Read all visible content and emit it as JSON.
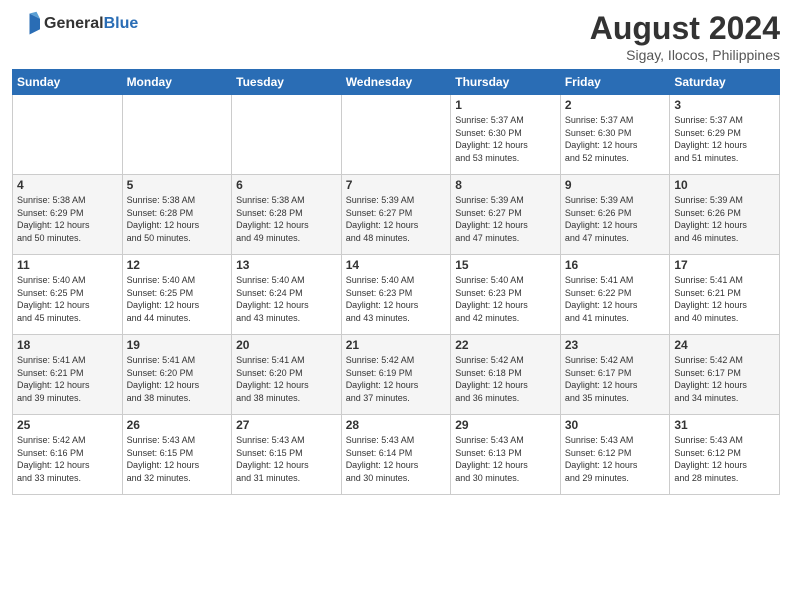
{
  "header": {
    "logo_general": "General",
    "logo_blue": "Blue",
    "month_year": "August 2024",
    "location": "Sigay, Ilocos, Philippines"
  },
  "weekdays": [
    "Sunday",
    "Monday",
    "Tuesday",
    "Wednesday",
    "Thursday",
    "Friday",
    "Saturday"
  ],
  "weeks": [
    [
      {
        "day": "",
        "info": ""
      },
      {
        "day": "",
        "info": ""
      },
      {
        "day": "",
        "info": ""
      },
      {
        "day": "",
        "info": ""
      },
      {
        "day": "1",
        "info": "Sunrise: 5:37 AM\nSunset: 6:30 PM\nDaylight: 12 hours\nand 53 minutes."
      },
      {
        "day": "2",
        "info": "Sunrise: 5:37 AM\nSunset: 6:30 PM\nDaylight: 12 hours\nand 52 minutes."
      },
      {
        "day": "3",
        "info": "Sunrise: 5:37 AM\nSunset: 6:29 PM\nDaylight: 12 hours\nand 51 minutes."
      }
    ],
    [
      {
        "day": "4",
        "info": "Sunrise: 5:38 AM\nSunset: 6:29 PM\nDaylight: 12 hours\nand 50 minutes."
      },
      {
        "day": "5",
        "info": "Sunrise: 5:38 AM\nSunset: 6:28 PM\nDaylight: 12 hours\nand 50 minutes."
      },
      {
        "day": "6",
        "info": "Sunrise: 5:38 AM\nSunset: 6:28 PM\nDaylight: 12 hours\nand 49 minutes."
      },
      {
        "day": "7",
        "info": "Sunrise: 5:39 AM\nSunset: 6:27 PM\nDaylight: 12 hours\nand 48 minutes."
      },
      {
        "day": "8",
        "info": "Sunrise: 5:39 AM\nSunset: 6:27 PM\nDaylight: 12 hours\nand 47 minutes."
      },
      {
        "day": "9",
        "info": "Sunrise: 5:39 AM\nSunset: 6:26 PM\nDaylight: 12 hours\nand 47 minutes."
      },
      {
        "day": "10",
        "info": "Sunrise: 5:39 AM\nSunset: 6:26 PM\nDaylight: 12 hours\nand 46 minutes."
      }
    ],
    [
      {
        "day": "11",
        "info": "Sunrise: 5:40 AM\nSunset: 6:25 PM\nDaylight: 12 hours\nand 45 minutes."
      },
      {
        "day": "12",
        "info": "Sunrise: 5:40 AM\nSunset: 6:25 PM\nDaylight: 12 hours\nand 44 minutes."
      },
      {
        "day": "13",
        "info": "Sunrise: 5:40 AM\nSunset: 6:24 PM\nDaylight: 12 hours\nand 43 minutes."
      },
      {
        "day": "14",
        "info": "Sunrise: 5:40 AM\nSunset: 6:23 PM\nDaylight: 12 hours\nand 43 minutes."
      },
      {
        "day": "15",
        "info": "Sunrise: 5:40 AM\nSunset: 6:23 PM\nDaylight: 12 hours\nand 42 minutes."
      },
      {
        "day": "16",
        "info": "Sunrise: 5:41 AM\nSunset: 6:22 PM\nDaylight: 12 hours\nand 41 minutes."
      },
      {
        "day": "17",
        "info": "Sunrise: 5:41 AM\nSunset: 6:21 PM\nDaylight: 12 hours\nand 40 minutes."
      }
    ],
    [
      {
        "day": "18",
        "info": "Sunrise: 5:41 AM\nSunset: 6:21 PM\nDaylight: 12 hours\nand 39 minutes."
      },
      {
        "day": "19",
        "info": "Sunrise: 5:41 AM\nSunset: 6:20 PM\nDaylight: 12 hours\nand 38 minutes."
      },
      {
        "day": "20",
        "info": "Sunrise: 5:41 AM\nSunset: 6:20 PM\nDaylight: 12 hours\nand 38 minutes."
      },
      {
        "day": "21",
        "info": "Sunrise: 5:42 AM\nSunset: 6:19 PM\nDaylight: 12 hours\nand 37 minutes."
      },
      {
        "day": "22",
        "info": "Sunrise: 5:42 AM\nSunset: 6:18 PM\nDaylight: 12 hours\nand 36 minutes."
      },
      {
        "day": "23",
        "info": "Sunrise: 5:42 AM\nSunset: 6:17 PM\nDaylight: 12 hours\nand 35 minutes."
      },
      {
        "day": "24",
        "info": "Sunrise: 5:42 AM\nSunset: 6:17 PM\nDaylight: 12 hours\nand 34 minutes."
      }
    ],
    [
      {
        "day": "25",
        "info": "Sunrise: 5:42 AM\nSunset: 6:16 PM\nDaylight: 12 hours\nand 33 minutes."
      },
      {
        "day": "26",
        "info": "Sunrise: 5:43 AM\nSunset: 6:15 PM\nDaylight: 12 hours\nand 32 minutes."
      },
      {
        "day": "27",
        "info": "Sunrise: 5:43 AM\nSunset: 6:15 PM\nDaylight: 12 hours\nand 31 minutes."
      },
      {
        "day": "28",
        "info": "Sunrise: 5:43 AM\nSunset: 6:14 PM\nDaylight: 12 hours\nand 30 minutes."
      },
      {
        "day": "29",
        "info": "Sunrise: 5:43 AM\nSunset: 6:13 PM\nDaylight: 12 hours\nand 30 minutes."
      },
      {
        "day": "30",
        "info": "Sunrise: 5:43 AM\nSunset: 6:12 PM\nDaylight: 12 hours\nand 29 minutes."
      },
      {
        "day": "31",
        "info": "Sunrise: 5:43 AM\nSunset: 6:12 PM\nDaylight: 12 hours\nand 28 minutes."
      }
    ]
  ]
}
